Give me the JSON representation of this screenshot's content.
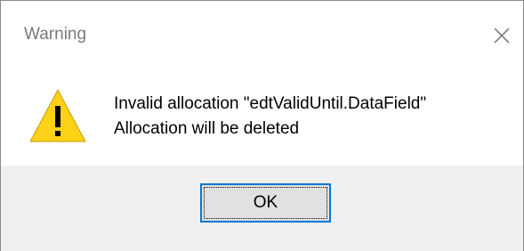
{
  "window": {
    "title": "Warning"
  },
  "icons": {
    "close": "close-icon",
    "warning": "warning-icon"
  },
  "message": {
    "line1": "Invalid allocation \"edtValidUntil.DataField\"",
    "line2": "Allocation will be deleted"
  },
  "buttons": {
    "ok_label": "OK"
  },
  "colors": {
    "warning_fill": "#fcd116",
    "focus_border": "#0078d7",
    "footer_bg": "#f0f0f0"
  }
}
